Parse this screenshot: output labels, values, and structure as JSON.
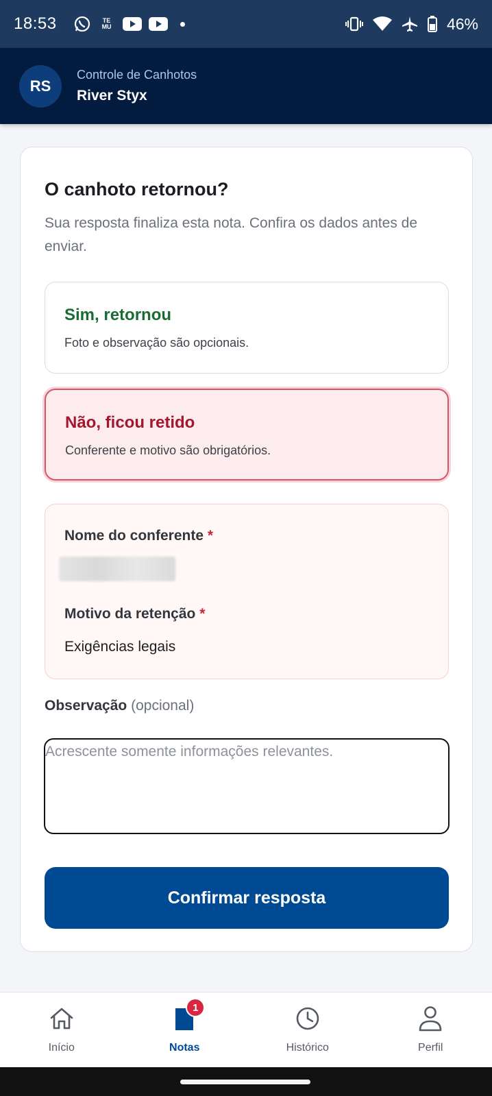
{
  "status_bar": {
    "time": "18:53",
    "temu_line1": "TE",
    "temu_line2": "MU",
    "battery": "46%",
    "icons": [
      "whatsapp-icon",
      "temu-icon",
      "youtube-icon",
      "youtube-icon",
      "vibrate-icon",
      "wifi-icon",
      "airplane-icon",
      "battery-icon"
    ]
  },
  "app_bar": {
    "avatar_initials": "RS",
    "subtitle": "Controle de Canhotos",
    "title": "River Styx"
  },
  "form": {
    "title": "O canhoto retornou?",
    "description": "Sua resposta finaliza esta nota. Confira os dados antes de enviar.",
    "options": [
      {
        "title": "Sim, retornou",
        "description": "Foto e observação são opcionais.",
        "selected": false,
        "color": "#1a6b34"
      },
      {
        "title": "Não, ficou retido",
        "description": "Conferente e motivo são obrigatórios.",
        "selected": true,
        "color": "#a3162d"
      }
    ],
    "retention": {
      "conferente_label": "Nome do conferente",
      "required_mark": "*",
      "motivo_label": "Motivo da retenção",
      "motivo_value": "Exigências legais"
    },
    "observation": {
      "label": "Observação",
      "optional": "(opcional)",
      "placeholder": "Acrescente somente informações relevantes.",
      "value": ""
    },
    "confirm_label": "Confirmar resposta"
  },
  "bottom_nav": {
    "items": [
      {
        "label": "Início",
        "icon": "home-icon",
        "active": false
      },
      {
        "label": "Notas",
        "icon": "note-icon",
        "active": true,
        "badge": "1"
      },
      {
        "label": "Histórico",
        "icon": "clock-icon",
        "active": false
      },
      {
        "label": "Perfil",
        "icon": "person-icon",
        "active": false
      }
    ]
  },
  "colors": {
    "primary": "#004a93",
    "app_bar": "#021b3f",
    "status_bar": "#1e3a5f",
    "danger": "#a3162d",
    "success": "#1a6b34"
  }
}
